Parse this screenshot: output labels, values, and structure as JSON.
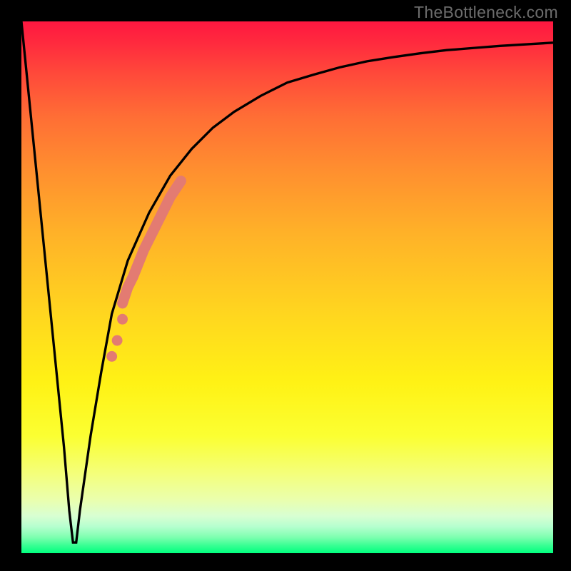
{
  "watermark": "TheBottleneck.com",
  "chart_data": {
    "type": "line",
    "title": "",
    "xlabel": "",
    "ylabel": "",
    "xlim": [
      0,
      100
    ],
    "ylim": [
      0,
      100
    ],
    "series": [
      {
        "name": "bottleneck-curve",
        "x": [
          0,
          2,
          4,
          6,
          8,
          9,
          9.7,
          10.3,
          11,
          13,
          15,
          17,
          20,
          24,
          28,
          32,
          36,
          40,
          45,
          50,
          55,
          60,
          65,
          70,
          75,
          80,
          85,
          90,
          95,
          100
        ],
        "values": [
          100,
          80,
          60,
          40,
          20,
          8,
          2,
          2,
          8,
          22,
          34,
          45,
          55,
          64,
          71,
          76,
          80,
          83,
          86,
          88.5,
          90,
          91.4,
          92.5,
          93.3,
          94,
          94.6,
          95,
          95.4,
          95.7,
          96
        ]
      },
      {
        "name": "highlight-band",
        "x": [
          19,
          20,
          21,
          22,
          23,
          24,
          25,
          26,
          27,
          28,
          29,
          30
        ],
        "values": [
          47,
          50,
          52,
          54.5,
          57,
          59,
          61,
          63,
          65,
          67,
          68.5,
          70
        ]
      },
      {
        "name": "highlight-dots",
        "x": [
          17,
          18,
          19
        ],
        "values": [
          37,
          40,
          44
        ]
      }
    ],
    "colors": {
      "curve": "#000000",
      "highlight": "#e37b72",
      "gradient_top": "#ff1740",
      "gradient_mid": "#ffd61f",
      "gradient_bottom": "#00ff7e",
      "frame": "#000000"
    }
  }
}
